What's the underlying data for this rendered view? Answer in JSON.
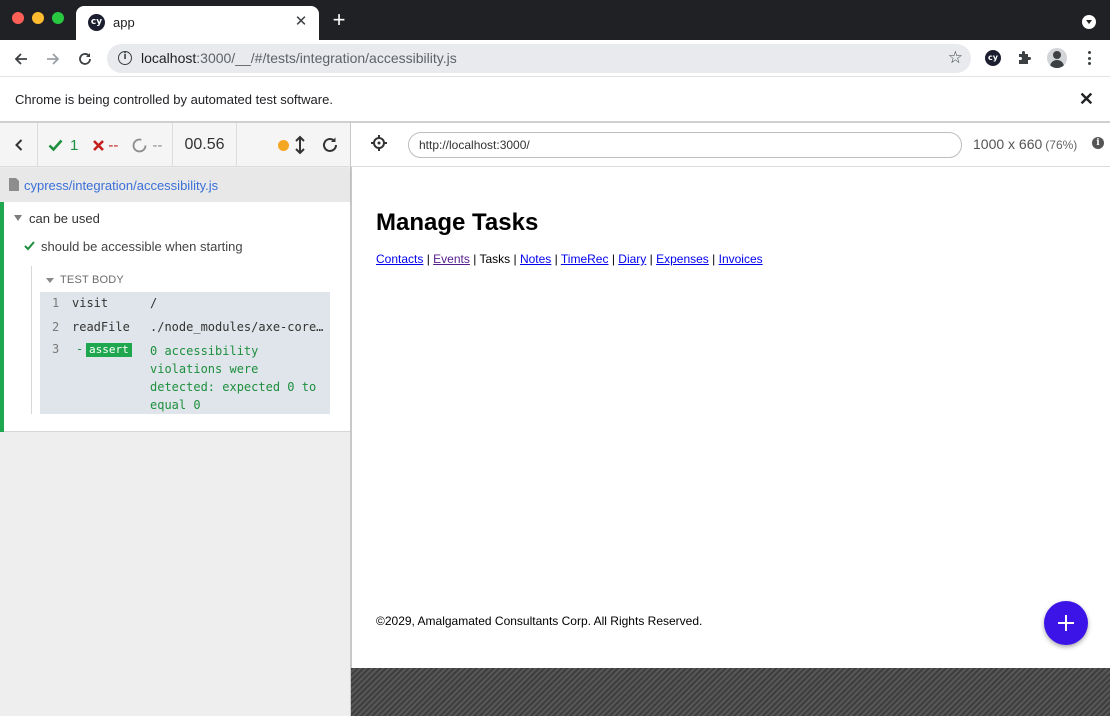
{
  "browser": {
    "tab_title": "app",
    "tab_favicon_text": "cy",
    "url_host": "localhost",
    "url_rest": ":3000/__/#/tests/integration/accessibility.js",
    "infobar_text": "Chrome is being controlled by automated test software.",
    "extension_cy_text": "cy"
  },
  "runner": {
    "stats": {
      "passed": "1",
      "failed": "--",
      "pending": "--"
    },
    "duration": "00.56",
    "spec_path": "cypress/integration/accessibility.js",
    "suite_title": "can be used",
    "test_title": "should be accessible when starting",
    "test_body_label": "TEST BODY",
    "commands": [
      {
        "num": "1",
        "name": "visit",
        "message": "/"
      },
      {
        "num": "2",
        "name": "readFile",
        "message": "./node_modules/axe-core/axe.min.js"
      },
      {
        "num": "3",
        "dash": "-",
        "name": "assert",
        "message": "0 accessibility violations were detected: expected 0 to equal 0"
      }
    ],
    "status_color_pass": "#1fa750",
    "status_color_running": "#f5a623"
  },
  "preview": {
    "url": "http://localhost:3000/",
    "viewport": "1000 x 660",
    "scale": "(76%)",
    "info_glyph": "i"
  },
  "app": {
    "heading": "Manage Tasks",
    "nav": [
      {
        "label": "Contacts"
      },
      {
        "label": "Events"
      },
      {
        "label": "Tasks"
      },
      {
        "label": "Notes"
      },
      {
        "label": "TimeRec"
      },
      {
        "label": "Diary"
      },
      {
        "label": "Expenses"
      },
      {
        "label": "Invoices"
      }
    ],
    "separator": "|",
    "footer": "©2029, Amalgamated Consultants Corp. All Rights Reserved.",
    "fab_color": "#3d14e8"
  }
}
